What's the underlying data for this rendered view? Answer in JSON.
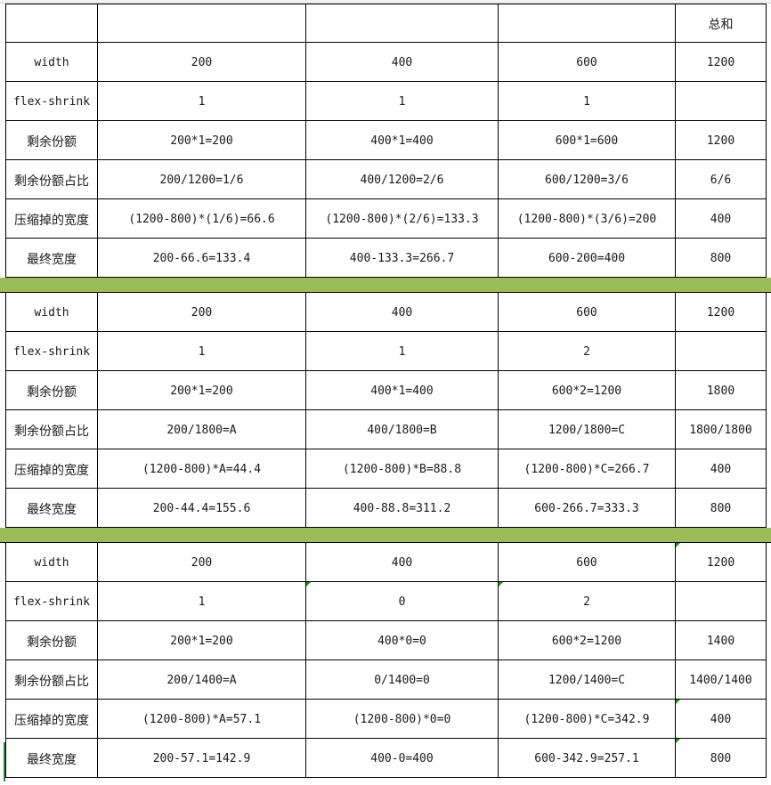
{
  "header": {
    "total_label": "总和"
  },
  "sections": [
    {
      "width": [
        "width",
        "200",
        "400",
        "600",
        "1200"
      ],
      "flex_shrink": [
        "flex-shrink",
        "1",
        "1",
        "1",
        ""
      ],
      "remaining_share": [
        "剩余份额",
        "200*1=200",
        "400*1=400",
        "600*1=600",
        "1200"
      ],
      "share_ratio": [
        "剩余份额占比",
        "200/1200=1/6",
        "400/1200=2/6",
        "600/1200=3/6",
        "6/6"
      ],
      "compressed_width": [
        "压缩掉的宽度",
        "(1200-800)*(1/6)=66.6",
        "(1200-800)*(2/6)=133.3",
        "(1200-800)*(3/6)=200",
        "400"
      ],
      "final_width": [
        "最终宽度",
        "200-66.6=133.4",
        "400-133.3=266.7",
        "600-200=400",
        "800"
      ]
    },
    {
      "width": [
        "width",
        "200",
        "400",
        "600",
        "1200"
      ],
      "flex_shrink": [
        "flex-shrink",
        "1",
        "1",
        "2",
        ""
      ],
      "remaining_share": [
        "剩余份额",
        "200*1=200",
        "400*1=400",
        "600*2=1200",
        "1800"
      ],
      "share_ratio": [
        "剩余份额占比",
        "200/1800=A",
        "400/1800=B",
        "1200/1800=C",
        "1800/1800"
      ],
      "compressed_width": [
        "压缩掉的宽度",
        "(1200-800)*A=44.4",
        "(1200-800)*B=88.8",
        "(1200-800)*C=266.7",
        "400"
      ],
      "final_width": [
        "最终宽度",
        "200-44.4=155.6",
        "400-88.8=311.2",
        "600-266.7=333.3",
        "800"
      ]
    },
    {
      "width": [
        "width",
        "200",
        "400",
        "600",
        "1200"
      ],
      "flex_shrink": [
        "flex-shrink",
        "1",
        "0",
        "2",
        ""
      ],
      "remaining_share": [
        "剩余份额",
        "200*1=200",
        "400*0=0",
        "600*2=1200",
        "1400"
      ],
      "share_ratio": [
        "剩余份额占比",
        "200/1400=A",
        "0/1400=0",
        "1200/1400=C",
        "1400/1400"
      ],
      "compressed_width": [
        "压缩掉的宽度",
        "(1200-800)*A=57.1",
        "(1200-800)*0=0",
        "(1200-800)*C=342.9",
        "400"
      ],
      "final_width": [
        "最终宽度",
        "200-57.1=142.9",
        "400-0=400",
        "600-342.9=257.1",
        "800"
      ]
    }
  ],
  "colors": {
    "divider": "#9bbb59",
    "grid": "#000000",
    "comment_marker": "#00a000"
  }
}
